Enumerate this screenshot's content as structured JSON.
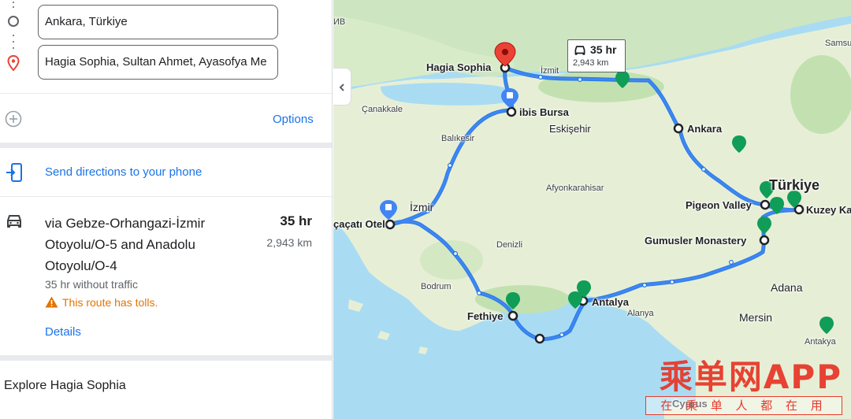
{
  "directions": {
    "origin_value": "Ankara, Türkiye",
    "destination_value": "Hagia Sophia, Sultan Ahmet, Ayasofya Me",
    "options_label": "Options",
    "send_to_phone_label": "Send directions to your phone"
  },
  "route": {
    "via_text": "via Gebze-Orhangazi-İzmir Otoyolu/O-5 and Anadolu Otoyolu/O-4",
    "duration": "35 hr",
    "distance": "2,943 km",
    "traffic_note": "35 hr without traffic",
    "tolls_warning": "This route has tolls.",
    "details_label": "Details"
  },
  "explore": {
    "label": "Explore Hagia Sophia"
  },
  "map": {
    "bubble_duration": "35 hr",
    "bubble_distance": "2,943 km",
    "labels": {
      "hagia_sophia": "Hagia Sophia",
      "ibis_bursa": "ibis Bursa",
      "eskisehir": "Eskişehir",
      "ankara": "Ankara",
      "turkiye": "Türkiye",
      "pigeon_valley": "Pigeon Valley",
      "kuzey": "Kuzey Ka",
      "gumusler": "Gumusler Monastery",
      "adana": "Adana",
      "mersin": "Mersin",
      "antakya": "Antakya",
      "antalya": "Antalya",
      "alanya": "Alanya",
      "fethiye": "Fethiye",
      "bodrum": "Bodrum",
      "denizli": "Denizli",
      "izmir": "İzmir",
      "cesme_otel": "çaçatı Otel",
      "afyon": "Afyonkarahisar",
      "balikesir": "Balıkesir",
      "canakkale": "Çanakkale",
      "izmit": "İzmit",
      "samsun": "Samsun",
      "cyprus": "Cyprus",
      "mb": "ИВ"
    }
  },
  "watermark": {
    "main": "乘单网APP",
    "sub": "在 乘 单 人 都 在 用"
  },
  "colors": {
    "route_blue": "#1a73e8",
    "link_blue": "#1a73e8",
    "warning_orange": "#e37400",
    "pin_red": "#ea4335",
    "watermark_red": "#e8392b"
  }
}
